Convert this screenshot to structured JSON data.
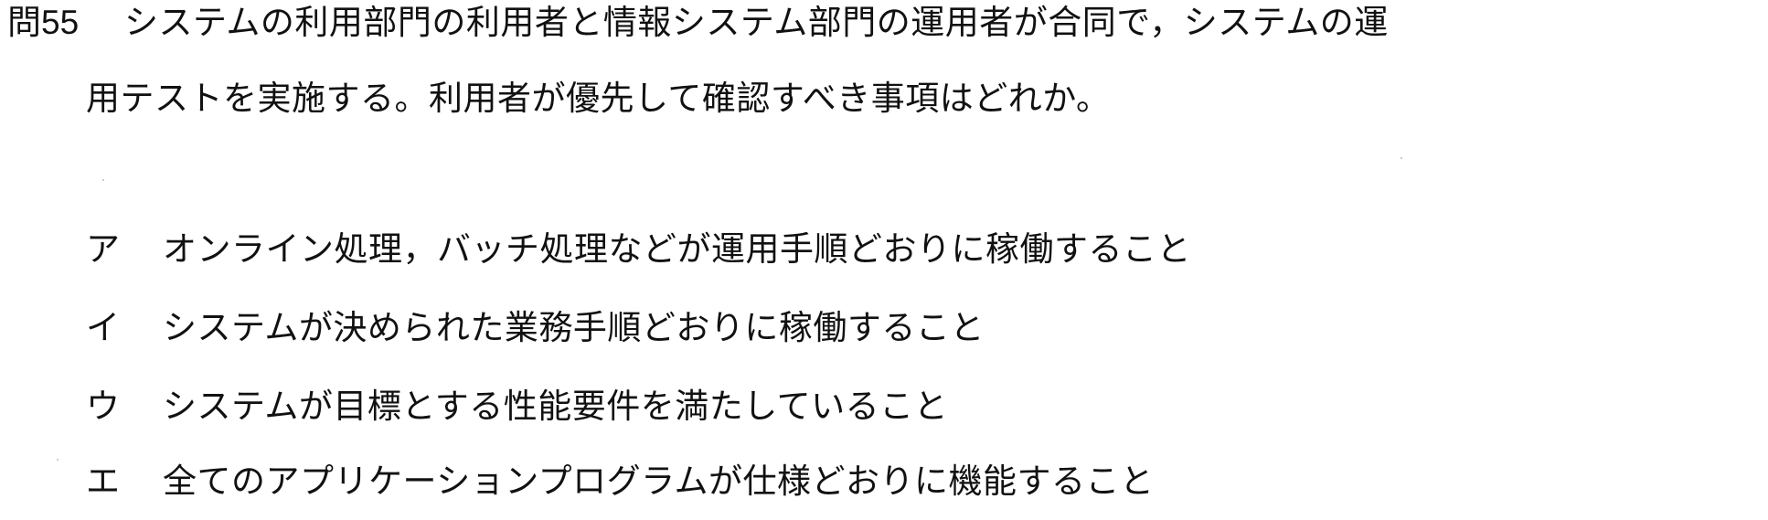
{
  "question": {
    "number": "問55",
    "line1": "システムの利用部門の利用者と情報システム部門の運用者が合同で，システムの運",
    "line2": "用テストを実施する。利用者が優先して確認すべき事項はどれか。"
  },
  "choices": [
    {
      "label": "ア",
      "text": "オンライン処理，バッチ処理などが運用手順どおりに稼働すること"
    },
    {
      "label": "イ",
      "text": "システムが決められた業務手順どおりに稼働すること"
    },
    {
      "label": "ウ",
      "text": "システムが目標とする性能要件を満たしていること"
    },
    {
      "label": "エ",
      "text": "全てのアプリケーションプログラムが仕様どおりに機能すること"
    }
  ]
}
